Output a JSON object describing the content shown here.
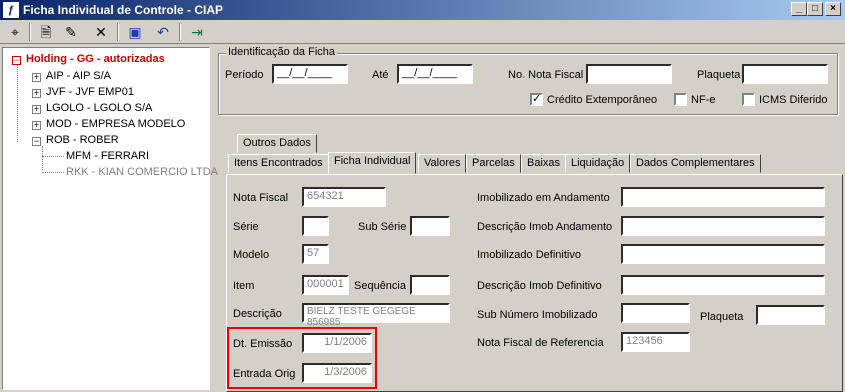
{
  "window": {
    "title": "Ficha Individual de Controle - CIAP",
    "min": "_",
    "max": "□",
    "close": "×"
  },
  "toolbar": {
    "icons": [
      "binoculars-icon",
      "new-document-icon",
      "edit-icon",
      "delete-icon",
      "save-icon",
      "undo-icon",
      "exit-icon"
    ],
    "glyphs": [
      "⌖",
      "🗎",
      "✎",
      "✕",
      "▣",
      "↶",
      "⇥"
    ]
  },
  "tree": {
    "root": "Holding -  GG -  autorizadas",
    "items": [
      "AIP - AIP S/A",
      "JVF - JVF  EMP01",
      "LGOLO - LGOLO S/A",
      "MOD - EMPRESA MODELO",
      "ROB - ROBER"
    ],
    "children": [
      "MFM - FERRARI",
      "RKK - KIAN COMERCIO LTDA"
    ],
    "plus": "+",
    "minus": "−"
  },
  "identificacao": {
    "legend": "Identificação da Ficha",
    "periodo_label": "Período",
    "periodo_value": "__/__/____",
    "ate_label": "Até",
    "ate_value": "__/__/____",
    "nota_label": "No. Nota Fiscal",
    "nota_value": "",
    "plaqueta_label": "Plaqueta",
    "plaqueta_value": "",
    "credito_label": "Crédito Extemporâneo",
    "credito_checked": "✓",
    "nfe_label": "NF-e",
    "icms_label": "ICMS Diferido"
  },
  "tabs": {
    "top": "Outros Dados",
    "row": [
      "Itens Encontrados",
      "Ficha Individual",
      "Valores",
      "Parcelas",
      "Baixas",
      "Liquidação",
      "Dados Complementares"
    ]
  },
  "form": {
    "nota_fiscal_label": "Nota Fiscal",
    "nota_fiscal_value": "654321",
    "serie_label": "Série",
    "serie_value": "",
    "sub_serie_label": "Sub Série",
    "sub_serie_value": "",
    "modelo_label": "Modelo",
    "modelo_value": "57",
    "item_label": "Item",
    "item_value": "000001",
    "sequencia_label": "Sequência",
    "sequencia_value": "",
    "descricao_label": "Descrição",
    "descricao_value": "BIELZ TESTE GEGEGE 856985",
    "dt_emissao_label": "Dt. Emissão",
    "dt_emissao_value": "1/1/2006",
    "entrada_orig_label": "Entrada Orig",
    "entrada_orig_value": "1/3/2006",
    "imob_andamento_label": "Imobilizado em Andamento",
    "imob_andamento_value": "",
    "desc_imob_andamento_label": "Descrição Imob Andamento",
    "desc_imob_andamento_value": "",
    "imob_definitivo_label": "Imobilizado Definitivo",
    "imob_definitivo_value": "",
    "desc_imob_definitivo_label": "Descrição Imob Definitivo",
    "desc_imob_definitivo_value": "",
    "sub_numero_label": "Sub Número Imobilizado",
    "sub_numero_value": "",
    "plaqueta_label": "Plaqueta",
    "plaqueta_value": "",
    "nf_referencia_label": "Nota Fiscal de Referencia",
    "nf_referencia_value": "123456"
  },
  "colors": {
    "highlight": "#e00000",
    "root_text": "#cc0000",
    "disabled_text": "#808080"
  }
}
